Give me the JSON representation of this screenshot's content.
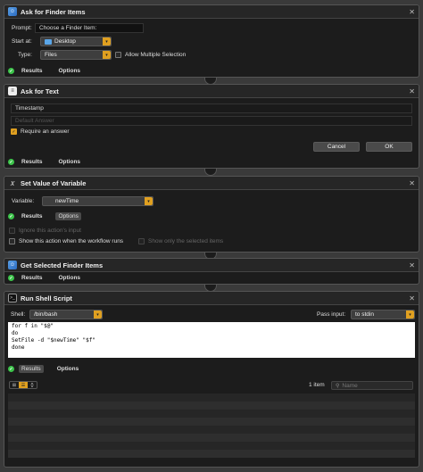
{
  "actions": [
    {
      "title": "Ask for Finder Items",
      "prompt_label": "Prompt:",
      "prompt_value": "Choose a Finder Item:",
      "start_at_label": "Start at:",
      "start_at_value": "Desktop",
      "type_label": "Type:",
      "type_value": "Files",
      "allow_multiple_label": "Allow Multiple Selection",
      "results_tab": "Results",
      "options_tab": "Options"
    },
    {
      "title": "Ask for Text",
      "question_value": "Timestamp",
      "default_answer_placeholder": "Default Answer",
      "require_label": "Require an answer",
      "cancel_label": "Cancel",
      "ok_label": "OK",
      "results_tab": "Results",
      "options_tab": "Options"
    },
    {
      "title": "Set Value of Variable",
      "variable_label": "Variable:",
      "variable_value": "newTime",
      "results_tab": "Results",
      "options_tab": "Options",
      "ignore_input_label": "Ignore this action's input",
      "show_when_runs_label": "Show this action when the workflow runs",
      "show_only_selected_label": "Show only the selected items"
    },
    {
      "title": "Get Selected Finder Items",
      "results_tab": "Results",
      "options_tab": "Options"
    },
    {
      "title": "Run Shell Script",
      "shell_label": "Shell:",
      "shell_value": "/bin/bash",
      "pass_input_label": "Pass input:",
      "pass_input_value": "to stdin",
      "script": "for f in \"$@\"\ndo\nSetFile -d \"$newTime\" \"$f\"\ndone",
      "results_tab": "Results",
      "options_tab": "Options",
      "item_count": "1 item",
      "search_placeholder": "Name"
    }
  ],
  "colors": {
    "accent": "#e0a020",
    "status_ok": "#3cc44a",
    "panel_bg": "#1c1c1c",
    "page_bg": "#3a3a3a"
  }
}
